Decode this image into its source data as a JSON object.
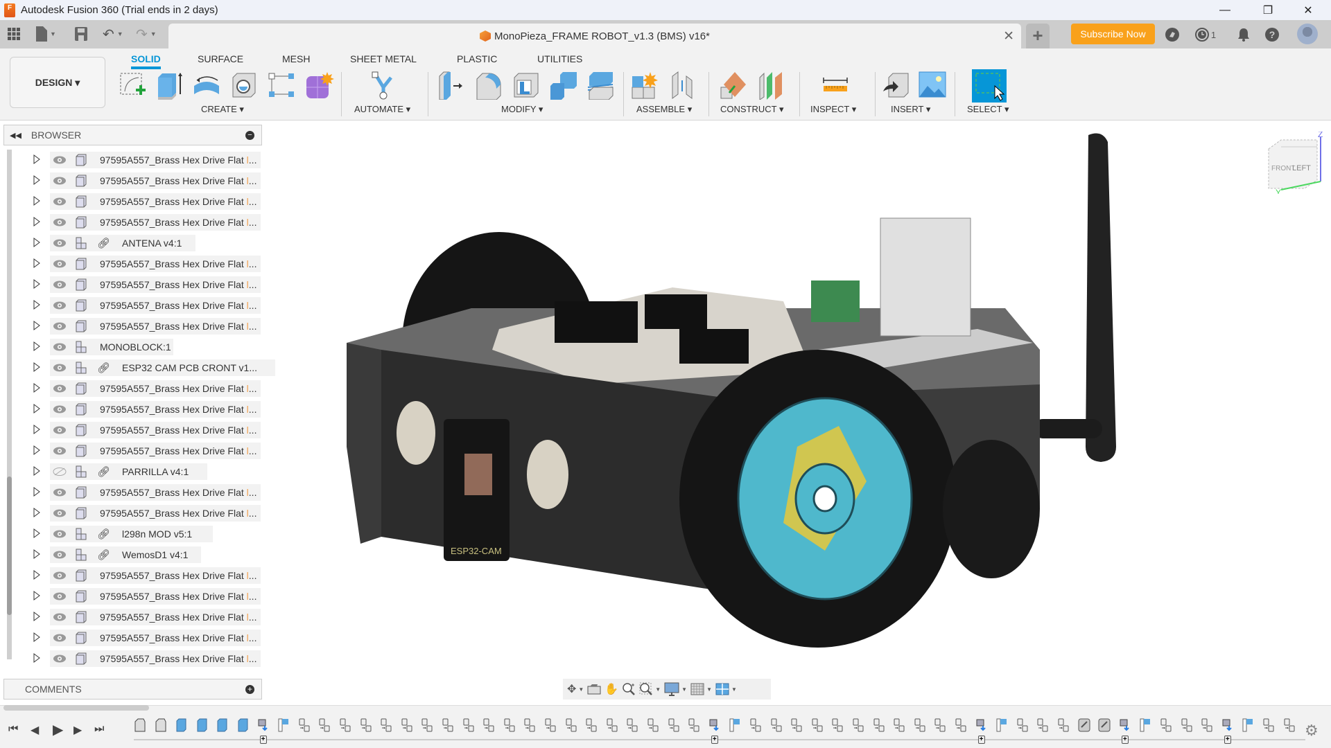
{
  "window": {
    "title": "Autodesk Fusion 360 (Trial ends in 2 days)",
    "app_icon": "fusion-360-logo",
    "app_icon_letter": "F",
    "controls": {
      "minimize": "—",
      "maximize": "❐",
      "close": "✕"
    }
  },
  "quick_access": {
    "icons": [
      "apps-grid-icon",
      "file-icon",
      "save-icon",
      "undo-icon",
      "redo-icon"
    ]
  },
  "document_tab": {
    "title": "MonoPieza_FRAME ROBOT_v1.3 (BMS) v16*",
    "close": "✕"
  },
  "header_right": {
    "new_tab": "+",
    "subscribe_label": "Subscribe Now",
    "jobs_count": "1",
    "icons": [
      "extensions-icon",
      "job-status-icon",
      "notifications-bell-icon",
      "help-icon",
      "user-avatar"
    ]
  },
  "ribbon": {
    "workspace": "DESIGN ▾",
    "tabs": [
      {
        "label": "SOLID",
        "active": true
      },
      {
        "label": "SURFACE",
        "active": false
      },
      {
        "label": "MESH",
        "active": false
      },
      {
        "label": "SHEET METAL",
        "active": false
      },
      {
        "label": "PLASTIC",
        "active": false
      },
      {
        "label": "UTILITIES",
        "active": false
      }
    ],
    "groups": [
      {
        "label": "CREATE ▾",
        "tools": [
          "create-sketch",
          "extrude",
          "revolve",
          "hole",
          "pattern",
          "create-form"
        ]
      },
      {
        "label": "AUTOMATE ▾",
        "tools": [
          "automate"
        ]
      },
      {
        "label": "MODIFY ▾",
        "tools": [
          "press-pull",
          "fillet",
          "shell",
          "combine",
          "split-face"
        ]
      },
      {
        "label": "ASSEMBLE ▾",
        "tools": [
          "new-component",
          "joint"
        ]
      },
      {
        "label": "CONSTRUCT ▾",
        "tools": [
          "offset-plane",
          "midplane"
        ]
      },
      {
        "label": "INSPECT ▾",
        "tools": [
          "measure"
        ]
      },
      {
        "label": "INSERT ▾",
        "tools": [
          "insert-derive",
          "insert-canvas"
        ]
      },
      {
        "label": "SELECT ▾",
        "tools": [
          "select"
        ]
      }
    ]
  },
  "browser": {
    "title": "BROWSER",
    "items": [
      {
        "name": "97595A557_Brass Hex Drive Flat",
        "type": "body",
        "visible": true,
        "linked": false,
        "truncated": true
      },
      {
        "name": "97595A557_Brass Hex Drive Flat",
        "type": "body",
        "visible": true,
        "linked": false,
        "truncated": true
      },
      {
        "name": "97595A557_Brass Hex Drive Flat",
        "type": "body",
        "visible": true,
        "linked": false,
        "truncated": true
      },
      {
        "name": "97595A557_Brass Hex Drive Flat",
        "type": "body",
        "visible": true,
        "linked": false,
        "truncated": true
      },
      {
        "name": "ANTENA v4:1",
        "type": "component",
        "visible": true,
        "linked": true,
        "truncated": false
      },
      {
        "name": "97595A557_Brass Hex Drive Flat",
        "type": "body",
        "visible": true,
        "linked": false,
        "truncated": true
      },
      {
        "name": "97595A557_Brass Hex Drive Flat",
        "type": "body",
        "visible": true,
        "linked": false,
        "truncated": true
      },
      {
        "name": "97595A557_Brass Hex Drive Flat",
        "type": "body",
        "visible": true,
        "linked": false,
        "truncated": true
      },
      {
        "name": "97595A557_Brass Hex Drive Flat",
        "type": "body",
        "visible": true,
        "linked": false,
        "truncated": true
      },
      {
        "name": "MONOBLOCK:1",
        "type": "assembly",
        "visible": true,
        "linked": false,
        "truncated": false
      },
      {
        "name": "ESP32 CAM PCB CRONT v1...",
        "type": "assembly",
        "visible": true,
        "linked": true,
        "truncated": false
      },
      {
        "name": "97595A557_Brass Hex Drive Flat",
        "type": "body",
        "visible": true,
        "linked": false,
        "truncated": true
      },
      {
        "name": "97595A557_Brass Hex Drive Flat",
        "type": "body",
        "visible": true,
        "linked": false,
        "truncated": true
      },
      {
        "name": "97595A557_Brass Hex Drive Flat",
        "type": "body",
        "visible": true,
        "linked": false,
        "truncated": true
      },
      {
        "name": "97595A557_Brass Hex Drive Flat",
        "type": "body",
        "visible": true,
        "linked": false,
        "truncated": true
      },
      {
        "name": "PARRILLA v4:1",
        "type": "assembly",
        "visible": false,
        "linked": true,
        "truncated": false
      },
      {
        "name": "97595A557_Brass Hex Drive Flat",
        "type": "body",
        "visible": true,
        "linked": false,
        "truncated": true
      },
      {
        "name": "97595A557_Brass Hex Drive Flat",
        "type": "body",
        "visible": true,
        "linked": false,
        "truncated": true
      },
      {
        "name": "l298n MOD v5:1",
        "type": "assembly",
        "visible": true,
        "linked": true,
        "truncated": false
      },
      {
        "name": "WemosD1 v4:1",
        "type": "assembly",
        "visible": true,
        "linked": true,
        "truncated": false
      },
      {
        "name": "97595A557_Brass Hex Drive Flat",
        "type": "body",
        "visible": true,
        "linked": false,
        "truncated": true
      },
      {
        "name": "97595A557_Brass Hex Drive Flat",
        "type": "body",
        "visible": true,
        "linked": false,
        "truncated": true
      },
      {
        "name": "97595A557_Brass Hex Drive Flat",
        "type": "body",
        "visible": true,
        "linked": false,
        "truncated": true
      },
      {
        "name": "97595A557_Brass Hex Drive Flat",
        "type": "body",
        "visible": true,
        "linked": false,
        "truncated": true
      },
      {
        "name": "97595A557_Brass Hex Drive Flat",
        "type": "body",
        "visible": true,
        "linked": false,
        "truncated": true
      }
    ]
  },
  "comments": {
    "title": "COMMENTS"
  },
  "viewcube": {
    "face_front": "LEFT",
    "face_side": "FRONT",
    "axis_z": "Z",
    "axis_y": "Y"
  },
  "nav_toolbar": {
    "tools": [
      "orbit-icon",
      "look-at-icon",
      "pan-icon",
      "zoom-icon",
      "fit-icon",
      "display-settings-icon",
      "grid-settings-icon",
      "viewports-icon"
    ]
  },
  "timeline": {
    "controls": [
      "first",
      "previous",
      "play",
      "next",
      "last"
    ],
    "sequence": "BBEEEEDFCCCCCCCCCCCCCCCCCCCCDFCCCCCCCCCCCDFCCCJJDFCCCDFCC"
  },
  "colors": {
    "accent": "#0696d7",
    "subscribe": "#f9a11b",
    "wheel_hub": "#4fb8cc",
    "chassis": "#3c3c3c"
  }
}
